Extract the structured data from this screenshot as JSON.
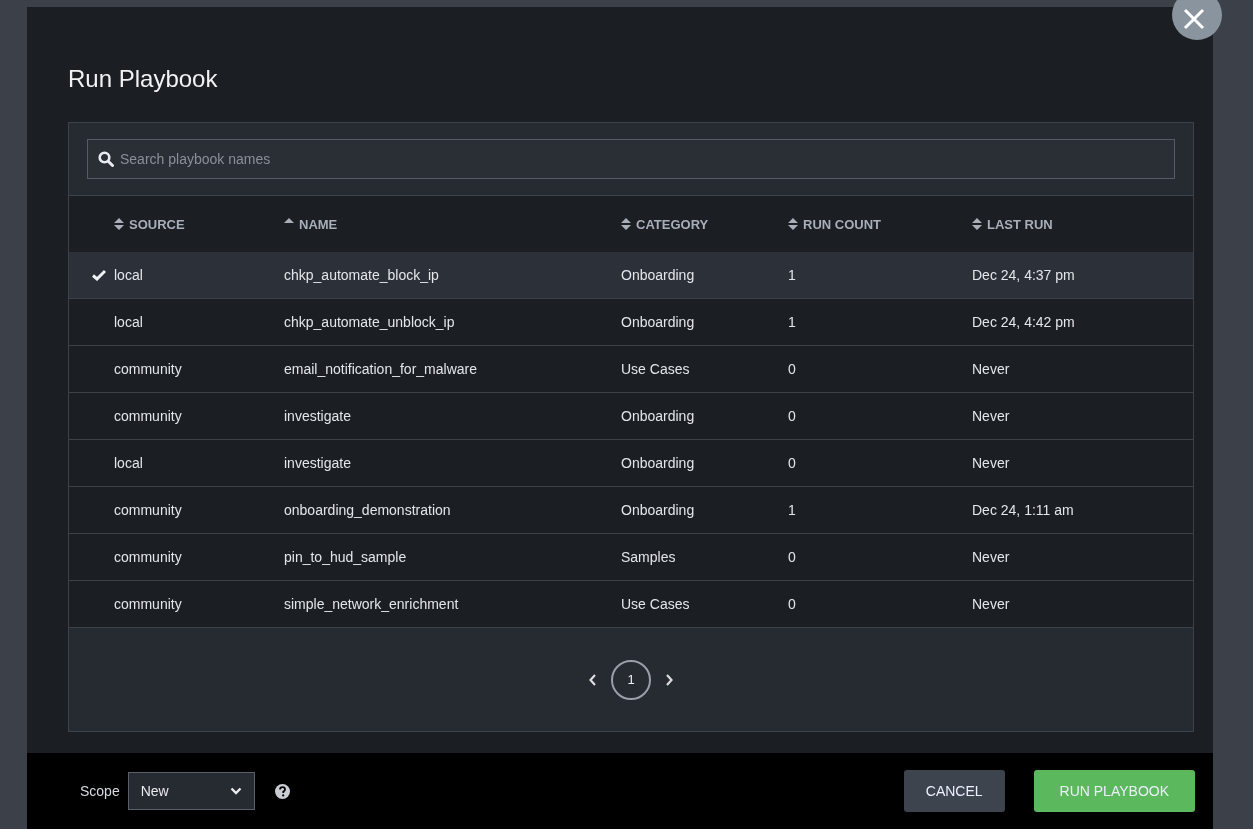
{
  "dialog": {
    "title": "Run Playbook"
  },
  "search": {
    "placeholder": "Search playbook names"
  },
  "table": {
    "columns": [
      {
        "label": "SOURCE",
        "sorted": false
      },
      {
        "label": "NAME",
        "sorted": true
      },
      {
        "label": "CATEGORY",
        "sorted": false
      },
      {
        "label": "RUN COUNT",
        "sorted": false
      },
      {
        "label": "LAST RUN",
        "sorted": false
      }
    ],
    "rows": [
      {
        "selected": true,
        "source": "local",
        "name": "chkp_automate_block_ip",
        "category": "Onboarding",
        "run_count": "1",
        "last_run": "Dec 24, 4:37 pm"
      },
      {
        "selected": false,
        "source": "local",
        "name": "chkp_automate_unblock_ip",
        "category": "Onboarding",
        "run_count": "1",
        "last_run": "Dec 24, 4:42 pm"
      },
      {
        "selected": false,
        "source": "community",
        "name": "email_notification_for_malware",
        "category": "Use Cases",
        "run_count": "0",
        "last_run": "Never"
      },
      {
        "selected": false,
        "source": "community",
        "name": "investigate",
        "category": "Onboarding",
        "run_count": "0",
        "last_run": "Never"
      },
      {
        "selected": false,
        "source": "local",
        "name": "investigate",
        "category": "Onboarding",
        "run_count": "0",
        "last_run": "Never"
      },
      {
        "selected": false,
        "source": "community",
        "name": "onboarding_demonstration",
        "category": "Onboarding",
        "run_count": "1",
        "last_run": "Dec 24, 1:11 am"
      },
      {
        "selected": false,
        "source": "community",
        "name": "pin_to_hud_sample",
        "category": "Samples",
        "run_count": "0",
        "last_run": "Never"
      },
      {
        "selected": false,
        "source": "community",
        "name": "simple_network_enrichment",
        "category": "Use Cases",
        "run_count": "0",
        "last_run": "Never"
      }
    ]
  },
  "pagination": {
    "pages": [
      {
        "label": "1",
        "selected": true
      }
    ]
  },
  "footer": {
    "scope_label": "Scope",
    "scope_value": "New",
    "buttons": [
      {
        "label": "CANCEL",
        "kind": "secondary"
      },
      {
        "label": "RUN PLAYBOOK",
        "kind": "primary"
      }
    ]
  }
}
